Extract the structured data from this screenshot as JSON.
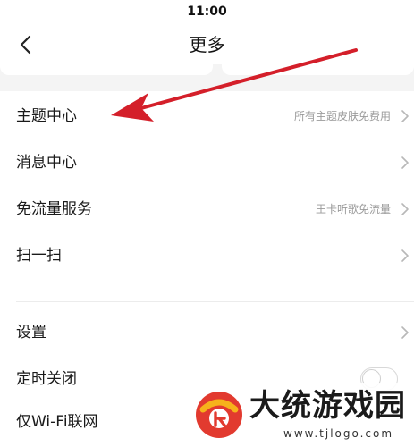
{
  "status_bar": {
    "time": "11:00"
  },
  "nav": {
    "title": "更多",
    "back_icon": "chevron-left-icon"
  },
  "menu_group_1": [
    {
      "label": "主题中心",
      "value": "所有主题皮肤免费用",
      "icon": "chevron-right-icon"
    },
    {
      "label": "消息中心",
      "value": "",
      "icon": "chevron-right-icon"
    },
    {
      "label": "免流量服务",
      "value": "王卡听歌免流量",
      "icon": "chevron-right-icon"
    },
    {
      "label": "扫一扫",
      "value": "",
      "icon": "chevron-right-icon"
    }
  ],
  "menu_group_2": [
    {
      "label": "设置",
      "icon": "chevron-right-icon"
    },
    {
      "label": "定时关闭",
      "toggle_on": false
    },
    {
      "label": "仅Wi-Fi联网"
    }
  ],
  "annotation": {
    "color": "#d41f2a",
    "icon": "red-arrow-annotation"
  },
  "watermark": {
    "title": "大统游戏园",
    "url": "www.tjlogo.com",
    "logo_icon": "watermark-logo"
  }
}
